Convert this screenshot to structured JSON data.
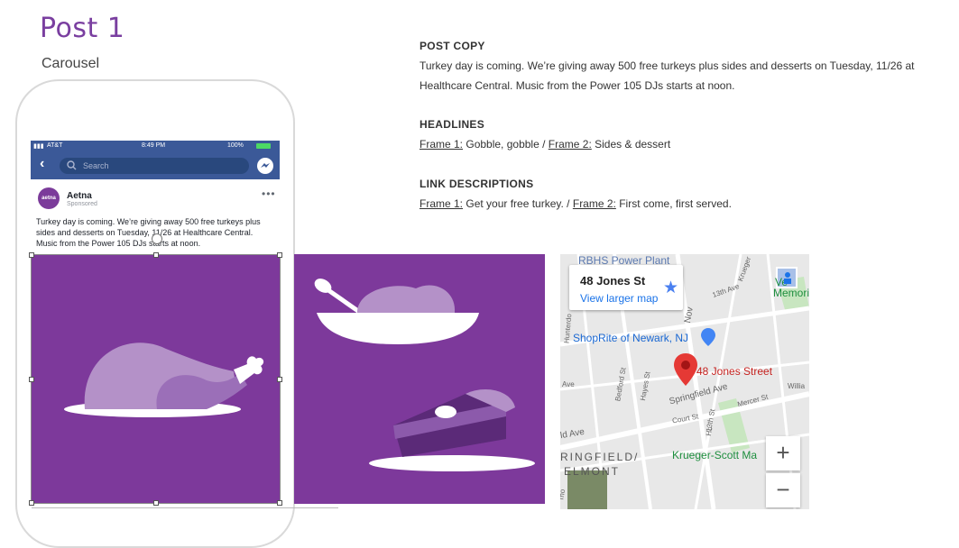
{
  "header": {
    "title": "Post 1",
    "subtitle": "Carousel"
  },
  "phone": {
    "status": {
      "carrier": "AT&T",
      "time": "8:49 PM",
      "battery": "100%"
    },
    "search_placeholder": "Search",
    "post": {
      "page_name": "Aetna",
      "sponsored": "Sponsored",
      "avatar_text": "aetna",
      "copy": "Turkey day is coming. We’re giving away 500 free turkeys plus sides and desserts on Tuesday, 11/26 at Healthcare Central. Music from the Power 105 DJs starts at noon."
    }
  },
  "post_copy": {
    "heading": "POST COPY",
    "line1": "Turkey day is coming. We’re giving away 500 free turkeys plus sides and desserts on Tuesday, 11/26 at",
    "line2": "Healthcare Central. Music from the Power 105 DJs starts at noon."
  },
  "headlines": {
    "heading": "HEADLINES",
    "frame1_label": "Frame 1:",
    "frame1_text": "Gobble, gobble /",
    "frame2_label": "Frame 2:",
    "frame2_text": "Sides & dessert"
  },
  "link_descriptions": {
    "heading": "LINK DESCRIPTIONS",
    "frame1_label": "Frame 1:",
    "frame1_text": "Get your free turkey. /",
    "frame2_label": "Frame 2:",
    "frame2_text": "First come, first served."
  },
  "map": {
    "card_title": "48 Jones St",
    "card_link": "View larger map",
    "pin_label": "48 Jones Street",
    "places": {
      "power_plant": "RBHS Power Plant",
      "shoprite": "ShopRite of Newark, NJ",
      "memorial": "Memorial P",
      "veterans": "Ve",
      "springfield": "RINGFIELD/",
      "belmont": "ELMONT",
      "park": "Krueger-Scott Ma"
    },
    "streets": {
      "s13th": "13th Ave",
      "springfield_ave": "Springfield Ave",
      "mercer": "Mercer St",
      "court": "Court St",
      "bedford": "Bedford St",
      "hayes": "Hayes St",
      "ave": "Ave",
      "ld_ave": "ld Ave",
      "willia": "Willia",
      "hunterdon": "Hunterdo",
      "krueger": "Krueger",
      "s13": "13th St",
      "nov": "Nov",
      "ho": "Ho",
      "rho": "rho"
    },
    "zoom_in": "+",
    "zoom_out": "−"
  },
  "colors": {
    "brand_purple": "#7d399b",
    "facebook_blue": "#3b5998"
  }
}
